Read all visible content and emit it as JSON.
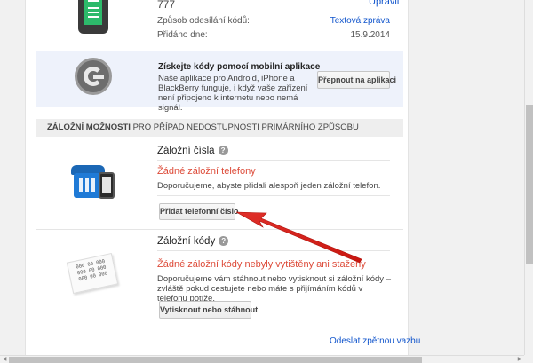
{
  "primary": {
    "phone_number": "777",
    "edit_link": "Upravit",
    "method_label": "Způsob odesílání kódů:",
    "method_value": "Textová zpráva",
    "added_label": "Přidáno dne:",
    "added_value": "15.9.2014"
  },
  "app_panel": {
    "title": "Získejte kódy pomocí mobilní aplikace",
    "description": "Naše aplikace pro Android, iPhone a BlackBerry funguje, i když vaše zařízení není připojeno k internetu nebo nemá signál.",
    "button": "Přepnout na aplikaci",
    "icon": "google-authenticator-icon"
  },
  "backup": {
    "header_bold": "ZÁLOŽNÍ MOŽNOSTI",
    "header_rest": " PRO PŘÍPAD NEDOSTUPNOSTI PRIMÁRNÍHO ZPŮSOBU",
    "numbers": {
      "title": "Záložní čísla",
      "help": "?",
      "empty": "Žádné záložní telefony",
      "hint": "Doporučujeme, abyste přidali alespoň jeden záložní telefon.",
      "button": "Přidat telefonní číslo",
      "icon": "desk-phone-icon"
    },
    "codes": {
      "title": "Záložní kódy",
      "help": "?",
      "empty": "Žádné záložní kódy nebyly vytištěny ani staženy",
      "hint": "Doporučujeme vám stáhnout nebo vytisknout si záložní kódy – zvláště pokud cestujete nebo máte s přijímáním kódů v telefonu potíže.",
      "button": "Vytisknout nebo stáhnout",
      "icon": "backup-codes-icon",
      "sheet_lines": [
        "000 00 000",
        "000 00 000",
        "000 00 000"
      ]
    }
  },
  "footer": {
    "feedback": "Odeslat zpětnou vazbu"
  },
  "colors": {
    "link": "#1155cc",
    "warning": "#dd4b39",
    "annotation_arrow": "#d9251c"
  }
}
